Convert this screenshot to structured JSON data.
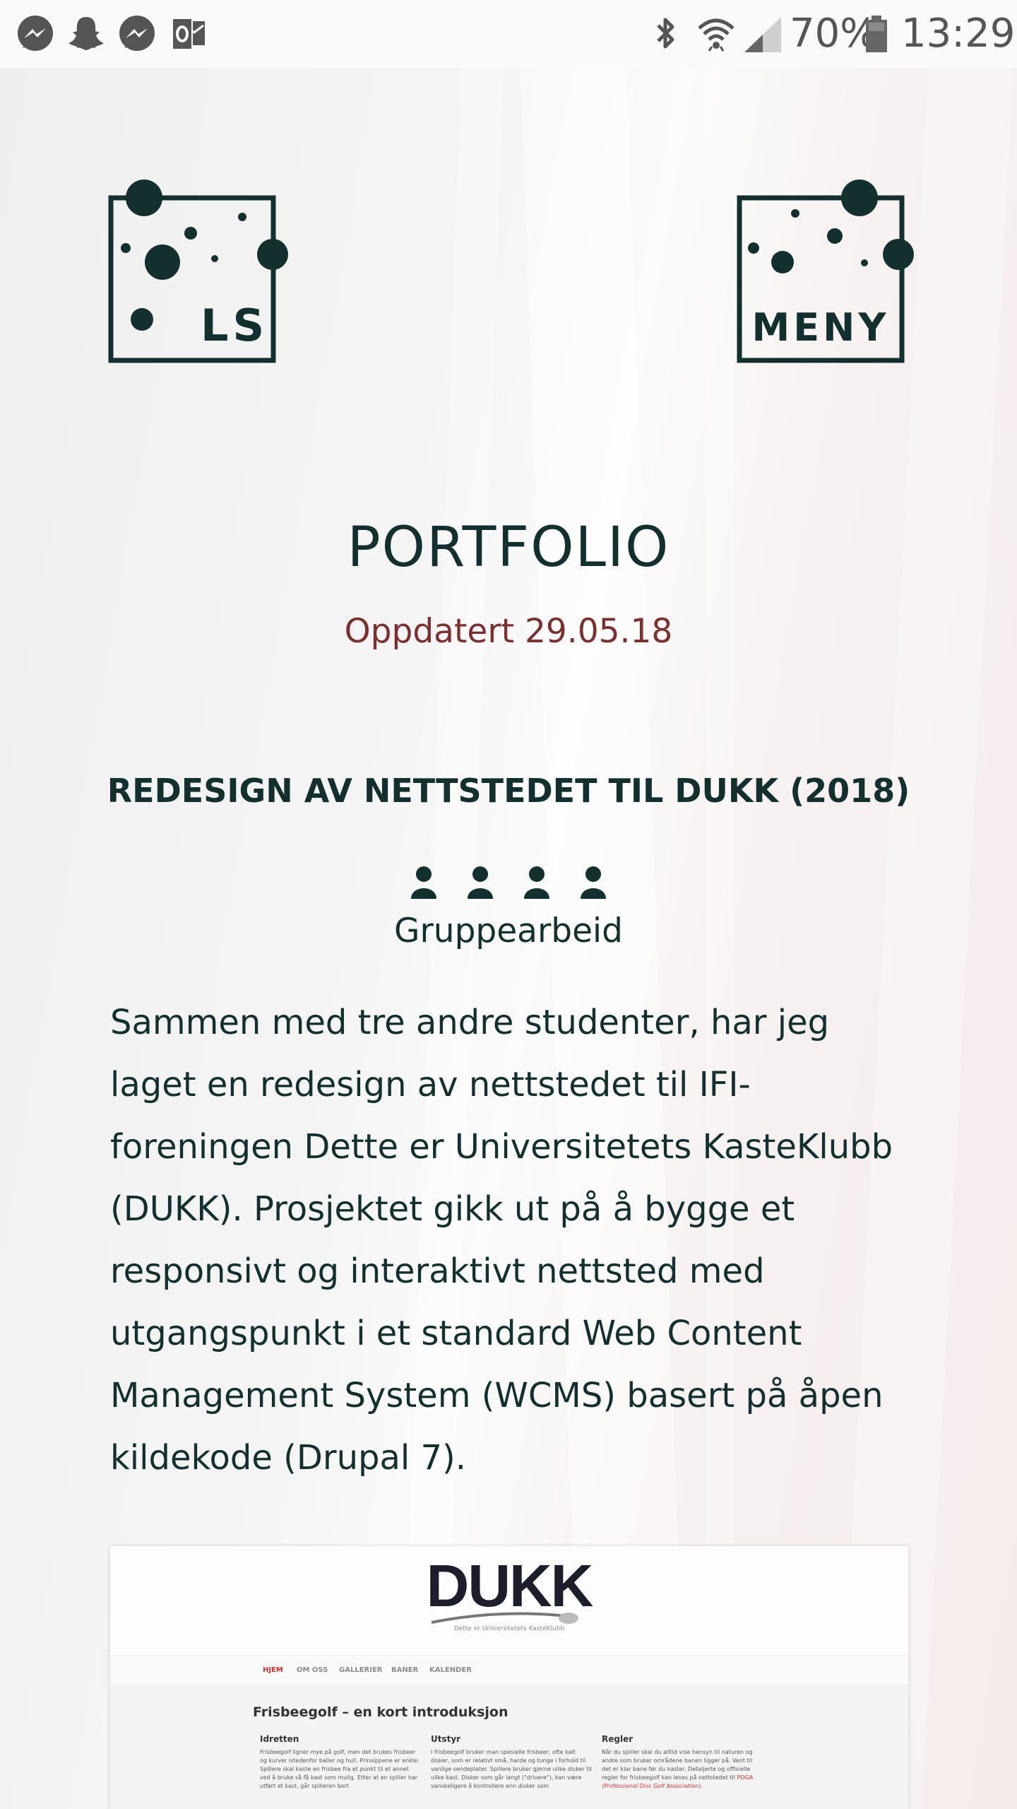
{
  "status_bar": {
    "left_icons": [
      "messenger-icon",
      "snapchat-icon",
      "messenger-icon",
      "outlook-icon"
    ],
    "right_icons": [
      "bluetooth-icon",
      "wifi-icon",
      "signal-icon",
      "battery-icon"
    ],
    "battery": "70%",
    "time": "13:29"
  },
  "header": {
    "logo_left": "LS",
    "menu_label": "MENY"
  },
  "main": {
    "title": "PORTFOLIO",
    "updated": "Oppdatert 29.05.18",
    "project_title": "REDESIGN AV NETTSTEDET TIL DUKK (2018)",
    "people_icons": [
      "person-icon",
      "person-icon",
      "person-icon",
      "person-icon"
    ],
    "group_label": "Gruppearbeid",
    "description": "Sammen med tre andre studenter, har jeg laget en redesign av nettstedet til IFI-foreningen Dette er Universitetets KasteKlubb (DUKK). Prosjektet gikk ut på å bygge et responsivt og interaktivt nettsted med utgangspunkt i et standard Web Content Management System (WCMS) basert på åpen kildekode (Drupal 7)."
  },
  "preview": {
    "logo": "DUKK",
    "tagline": "Dette er Universitetets KasteKlubb",
    "nav": [
      "HJEM",
      "OM OSS",
      "GALLERIER",
      "BANER",
      "KALENDER"
    ],
    "heading": "Frisbeegolf – en kort introduksjon",
    "columns": [
      {
        "title": "Idretten",
        "text": "Frisbeegolf ligner mye på golf, men det brukes frisbeer og kurver istedenfor baller og hull. Prinsippene er enkle: Spillere skal kaste en frisbee fra et punkt til et annet ved å bruke så få kast som mulig. Etter at en spiller har utført et kast, går spilleren bort"
      },
      {
        "title": "Utstyr",
        "text": "I frisbeegolf bruker man spesielle frisbeer, ofte kalt disker, som er relativt små, harde og tunge i forhold til vanlige sendeplater. Spillere bruker gjerne ulike disker til ulike kast. Disker som går langt (\"drivere\"), kan være vanskeligere å kontrollere enn disker som"
      },
      {
        "title": "Regler",
        "text": "Når du spiller skal du alltid vise hensyn til naturen og andre som bruker områdene banen ligger på. Vent til det er klar bane før du kaster. Detaljerte og offisielle regler for frisbeegolf kan leses på nettstedet til",
        "link": "PDGA (Professional Disc Golf Association)."
      }
    ]
  },
  "colors": {
    "primary": "#13302f",
    "accent": "#7b2f2f",
    "nav_active": "#d9302c"
  }
}
